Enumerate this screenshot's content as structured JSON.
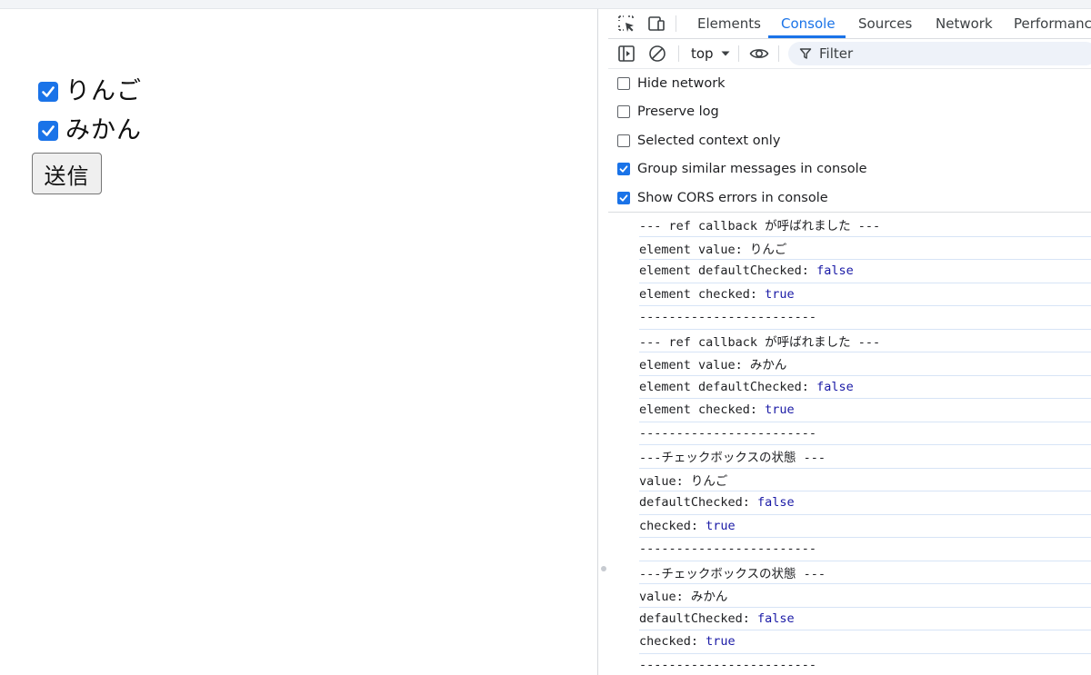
{
  "page": {
    "checkboxes": [
      {
        "label": "りんご",
        "checked": true
      },
      {
        "label": "みかん",
        "checked": true
      }
    ],
    "submit_label": "送信"
  },
  "devtools": {
    "tabs": [
      {
        "label": "Elements",
        "active": false
      },
      {
        "label": "Console",
        "active": true
      },
      {
        "label": "Sources",
        "active": false
      },
      {
        "label": "Network",
        "active": false
      },
      {
        "label": "Performance",
        "active": false
      }
    ],
    "toolbar": {
      "context": "top",
      "filter_placeholder": "Filter"
    },
    "settings": [
      {
        "label": "Hide network",
        "checked": false
      },
      {
        "label": "Preserve log",
        "checked": false
      },
      {
        "label": "Selected context only",
        "checked": false
      },
      {
        "label": "Group similar messages in console",
        "checked": true
      },
      {
        "label": "Show CORS errors in console",
        "checked": true
      }
    ],
    "log": [
      {
        "text": "--- ref callback が呼ばれました ---",
        "value": ""
      },
      {
        "text": "element value: りんご",
        "value": ""
      },
      {
        "text": "element defaultChecked: ",
        "value": "false"
      },
      {
        "text": "element checked: ",
        "value": "true"
      },
      {
        "text": "------------------------",
        "value": ""
      },
      {
        "text": "--- ref callback が呼ばれました ---",
        "value": ""
      },
      {
        "text": "element value: みかん",
        "value": ""
      },
      {
        "text": "element defaultChecked: ",
        "value": "false"
      },
      {
        "text": "element checked: ",
        "value": "true"
      },
      {
        "text": "------------------------",
        "value": ""
      },
      {
        "text": "---チェックボックスの状態 ---",
        "value": ""
      },
      {
        "text": "value: りんご",
        "value": ""
      },
      {
        "text": "defaultChecked: ",
        "value": "false"
      },
      {
        "text": "checked: ",
        "value": "true"
      },
      {
        "text": "------------------------",
        "value": ""
      },
      {
        "text": "---チェックボックスの状態 ---",
        "value": ""
      },
      {
        "text": "value: みかん",
        "value": ""
      },
      {
        "text": "defaultChecked: ",
        "value": "false"
      },
      {
        "text": "checked: ",
        "value": "true"
      },
      {
        "text": "------------------------",
        "value": ""
      }
    ]
  },
  "colors": {
    "accent": "#1a73e8",
    "log_value": "#1a1aa6",
    "log_separator": "#d7e4f6"
  }
}
